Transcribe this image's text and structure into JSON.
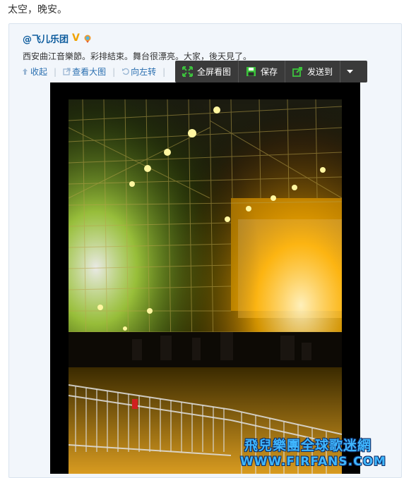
{
  "status_text": "太空，晚安。",
  "post": {
    "author": "@飞儿乐团",
    "text": "西安曲江音樂節。彩排結束。舞台很漂亮。大家，後天見了。"
  },
  "actions": {
    "collapse": "收起",
    "view_large": "查看大图",
    "rotate_left": "向左转"
  },
  "toolbar": {
    "fullscreen": "全屏看图",
    "save": "保存",
    "send_to": "发送到"
  },
  "watermark": {
    "line1": "飛兒樂團全球歌迷網",
    "line2": "WWW.FIRFANS.COM"
  },
  "colors": {
    "link": "#2a6fb0",
    "author": "#0a5a9c",
    "toolbar_bg": "#3a3a3a",
    "fullscreen_icon": "#3cc33c",
    "save_icon": "#3cc33c",
    "send_icon": "#3cc33c"
  },
  "icons": {
    "collapse": "arrow-up-icon",
    "view_large": "external-link-icon",
    "rotate_left": "rotate-left-icon",
    "fullscreen": "expand-icon",
    "save": "floppy-disk-icon",
    "send_to": "share-icon",
    "dropdown": "caret-down-icon"
  }
}
